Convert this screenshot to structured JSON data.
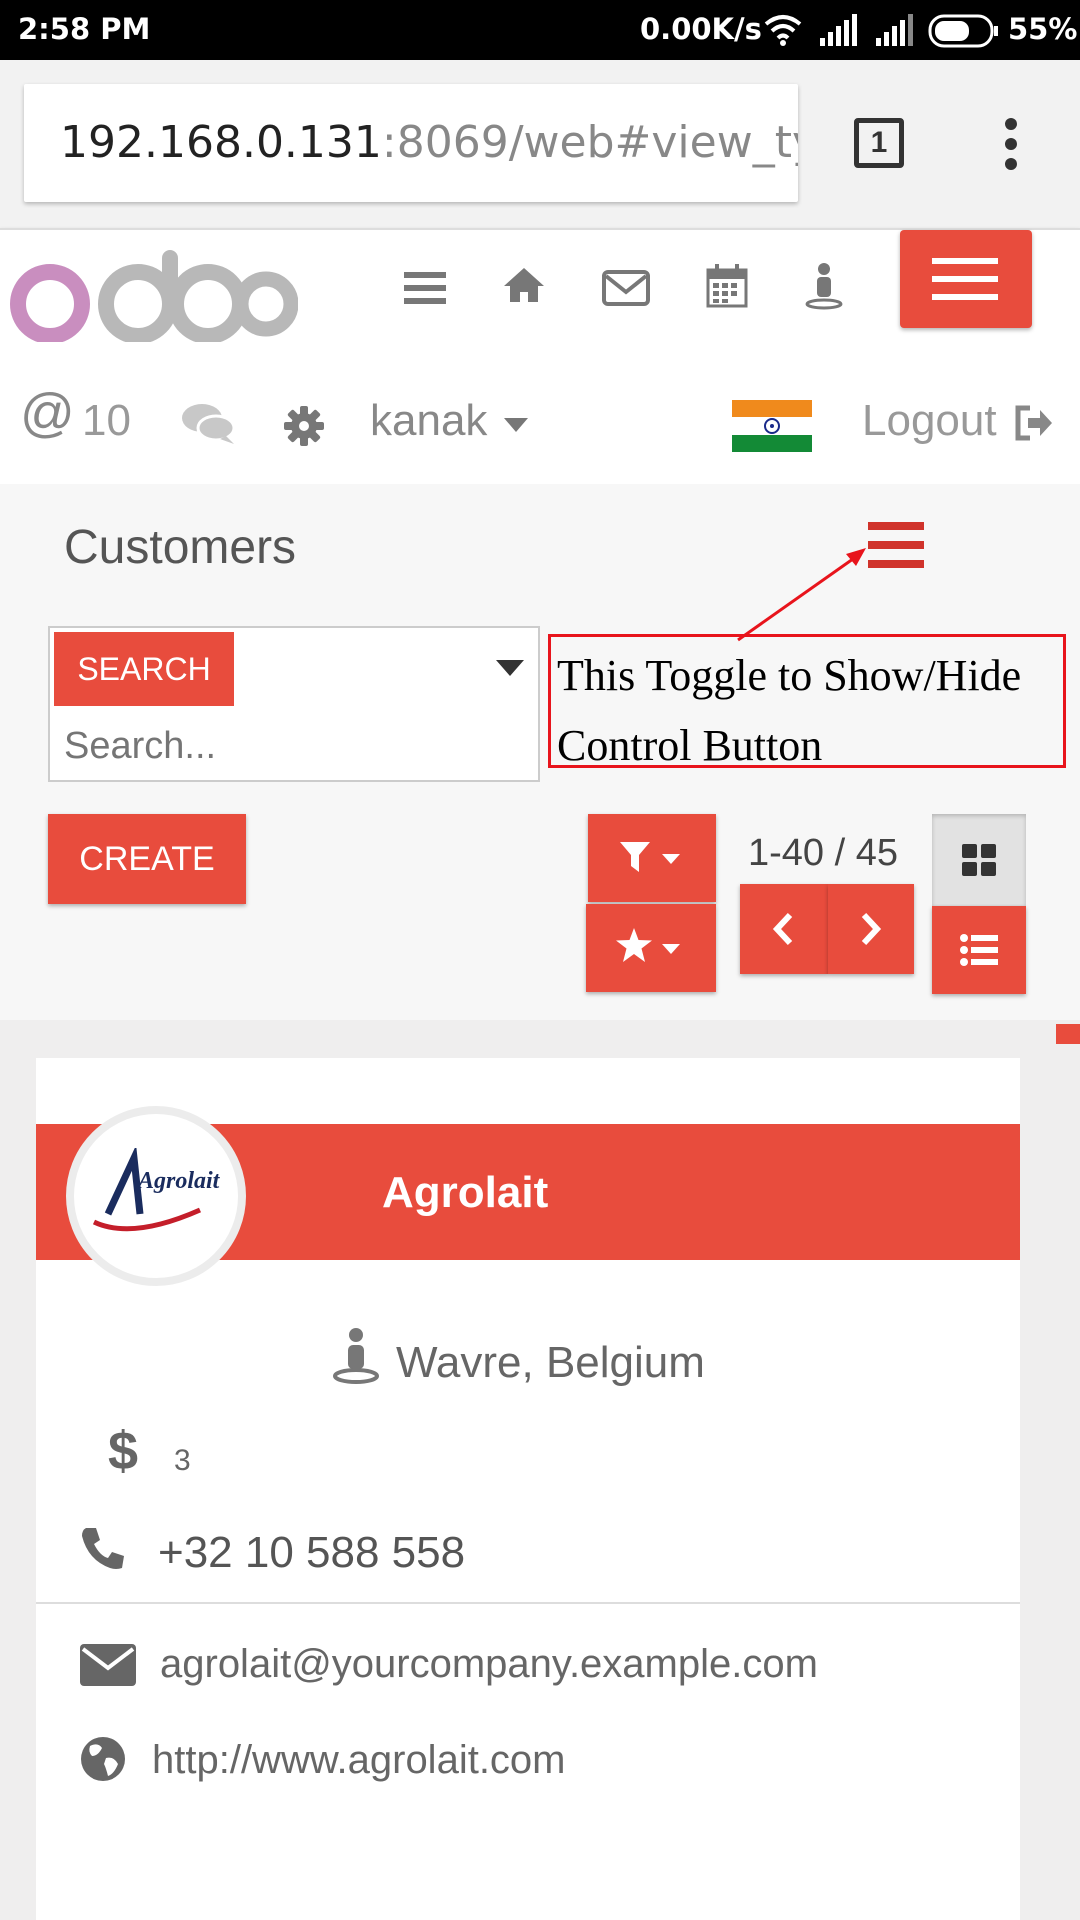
{
  "status_bar": {
    "time": "2:58 PM",
    "net_speed": "0.00K/s",
    "battery": "55%"
  },
  "browser": {
    "url_host": "192.168.0.131",
    "url_rest": ":8069/web#view_ty",
    "tab_count": "1"
  },
  "header": {
    "logo": "odoo",
    "mentions_count": "10",
    "user": "kanak",
    "logout_label": "Logout"
  },
  "control_panel": {
    "title": "Customers",
    "search_tag": "SEARCH",
    "search_placeholder": "Search...",
    "annotation": "This Toggle to Show/Hide Control Button",
    "create_label": "CREATE",
    "pager": "1-40 / 45"
  },
  "partner": {
    "name": "Agrolait",
    "logo_text": "Agrolait",
    "location": "Wavre, Belgium",
    "currency_symbol": "$",
    "count": "3",
    "phone": "+32 10 588 558",
    "email": "agrolait@yourcompany.example.com",
    "website": "http://www.agrolait.com"
  },
  "colors": {
    "accent": "#e84c3d",
    "annotation": "#e8141c",
    "icon_gray": "#777777"
  }
}
